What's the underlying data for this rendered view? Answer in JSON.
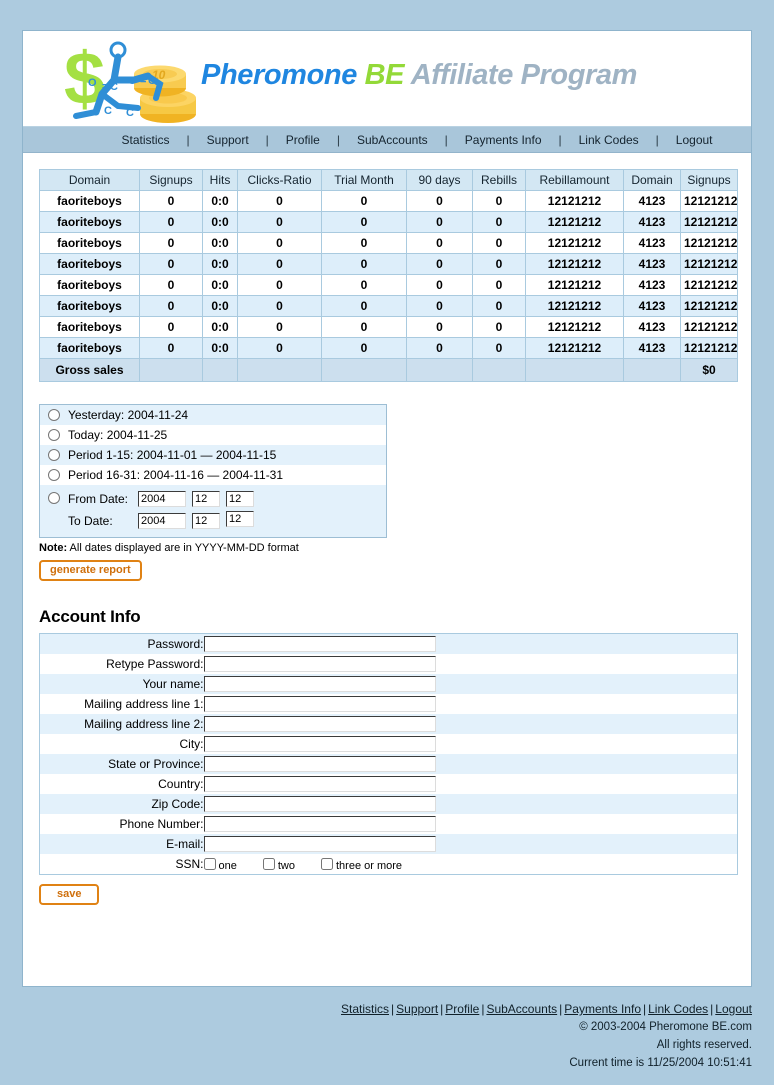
{
  "brand": {
    "part1": "Pheromone",
    "part2": "BE",
    "part3": "Affiliate Program",
    "color_blue": "#1f86e0",
    "color_green": "#93d938",
    "color_gray": "#9fb3c4"
  },
  "nav": {
    "items": [
      "Statistics",
      "Support",
      "Profile",
      "SubAccounts",
      "Payments Info",
      "Link Codes",
      "Logout"
    ],
    "separator": "|"
  },
  "stats_table": {
    "headers": [
      "Domain",
      "Signups",
      "Hits",
      "Clicks-Ratio",
      "Trial Month",
      "90 days",
      "Rebills",
      "Rebillamount",
      "Domain",
      "Signups"
    ],
    "rows": [
      [
        "faoriteboys",
        "0",
        "0:0",
        "0",
        "0",
        "0",
        "0",
        "12121212",
        "4123",
        "12121212"
      ],
      [
        "faoriteboys",
        "0",
        "0:0",
        "0",
        "0",
        "0",
        "0",
        "12121212",
        "4123",
        "12121212"
      ],
      [
        "faoriteboys",
        "0",
        "0:0",
        "0",
        "0",
        "0",
        "0",
        "12121212",
        "4123",
        "12121212"
      ],
      [
        "faoriteboys",
        "0",
        "0:0",
        "0",
        "0",
        "0",
        "0",
        "12121212",
        "4123",
        "12121212"
      ],
      [
        "faoriteboys",
        "0",
        "0:0",
        "0",
        "0",
        "0",
        "0",
        "12121212",
        "4123",
        "12121212"
      ],
      [
        "faoriteboys",
        "0",
        "0:0",
        "0",
        "0",
        "0",
        "0",
        "12121212",
        "4123",
        "12121212"
      ],
      [
        "faoriteboys",
        "0",
        "0:0",
        "0",
        "0",
        "0",
        "0",
        "12121212",
        "4123",
        "12121212"
      ],
      [
        "faoriteboys",
        "0",
        "0:0",
        "0",
        "0",
        "0",
        "0",
        "12121212",
        "4123",
        "12121212"
      ]
    ],
    "gross_label": "Gross sales",
    "gross_value": "$0"
  },
  "date_panel": {
    "options": [
      "Yesterday: 2004-11-24",
      "Today: 2004-11-25",
      "Period 1-15: 2004-11-01 — 2004-11-15",
      "Period 16-31: 2004-11-16 — 2004-11-31"
    ],
    "from_label": "From Date:",
    "to_label": "To Date:",
    "from_year": "2004",
    "from_month": "12",
    "from_day": "12",
    "to_year": "2004",
    "to_month": "12",
    "to_day": "12",
    "note_bold": "Note:",
    "note_text": " All dates displayed are in YYYY-MM-DD format",
    "generate_button": "generate report"
  },
  "account": {
    "title": "Account Info",
    "fields": [
      "Password:",
      "Retype Password:",
      "Your name:",
      "Mailing address line 1:",
      "Mailing address line 2:",
      "City:",
      "State or Province:",
      "Country:",
      "Zip Code:",
      "Phone Number:",
      "E-mail:"
    ],
    "ssn_label": "SSN:",
    "ssn_options": [
      "one",
      "two",
      "three or more"
    ],
    "save_button": "save"
  },
  "footer": {
    "links": [
      "Statistics",
      "Support",
      "Profile",
      "SubAccounts",
      "Payments Info",
      "Link Codes",
      "Logout "
    ],
    "separator": "|",
    "copyright": "© 2003-2004 Pheromone BE.com",
    "rights": "All rights reserved.",
    "current_time": "Current time is 11/25/2004 10:51:41"
  }
}
